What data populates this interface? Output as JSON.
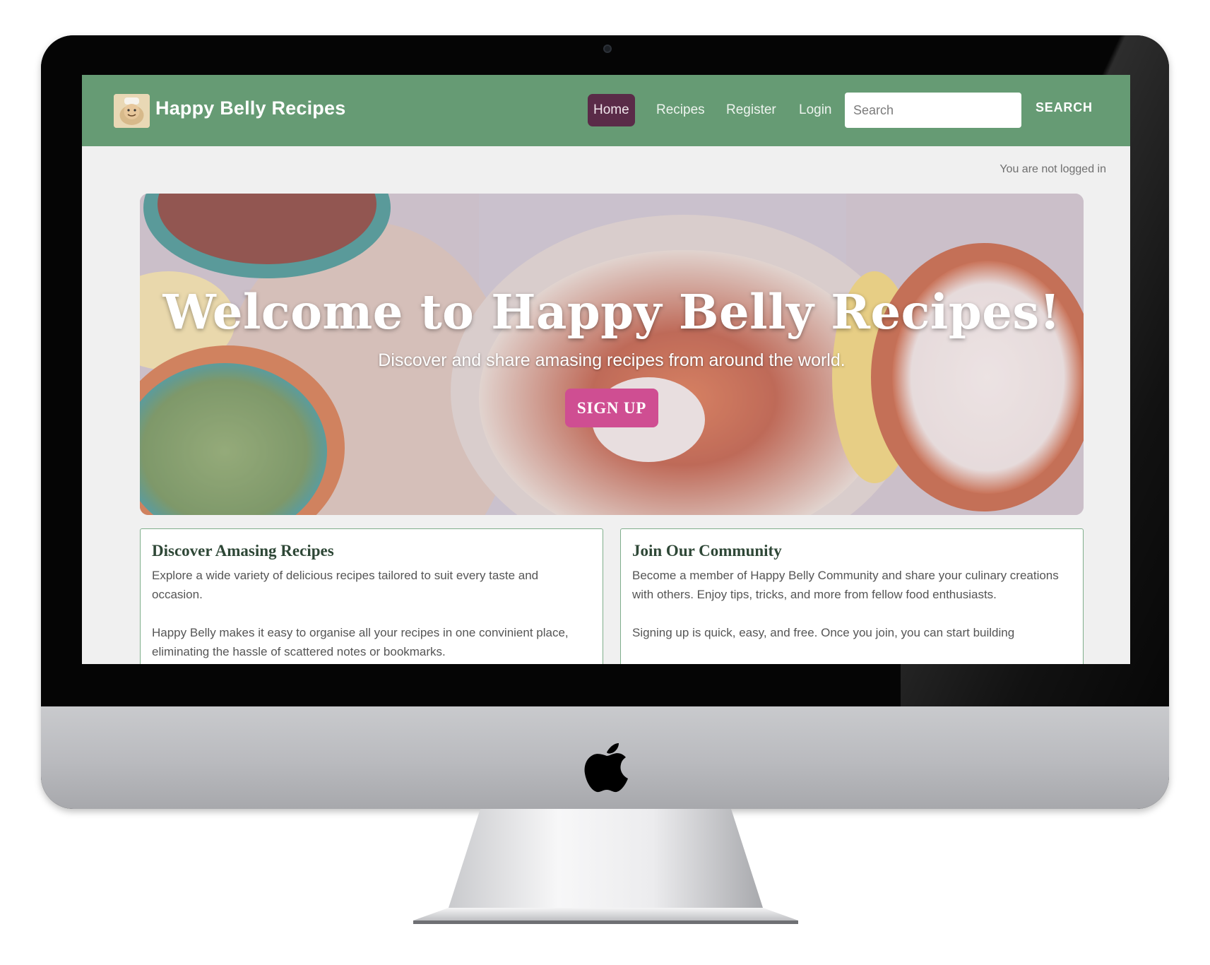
{
  "navbar": {
    "brand": "Happy Belly Recipes",
    "links": [
      "Home",
      "Recipes",
      "Register",
      "Login"
    ],
    "active": "Home",
    "search_placeholder": "Search",
    "search_button": "SEARCH"
  },
  "status": {
    "login_text": "You are not logged in"
  },
  "hero": {
    "title": "Welcome to Happy Belly Recipes!",
    "subtitle": "Discover and share amasing recipes from around the world.",
    "cta": "SIGN UP"
  },
  "cards": [
    {
      "title": "Discover Amasing Recipes",
      "paragraphs": [
        "Explore a wide variety of delicious recipes tailored to suit every taste and occasion.",
        "Happy Belly makes it easy to organise all your recipes in one convinient place, eliminating the hassle of scattered notes or bookmarks."
      ]
    },
    {
      "title": "Join Our Community",
      "paragraphs": [
        "Become a member of Happy Belly Community and share your culinary creations with others. Enjoy tips, tricks, and more from fellow food enthusiasts.",
        "Signing up is quick, easy, and free. Once you join, you can start building"
      ]
    }
  ],
  "colors": {
    "navbar": "#669b74",
    "active_link": "#5a2b48",
    "cta": "#cf4e92",
    "card_border": "#7fae8b"
  },
  "icons": [
    "brand-logo-icon",
    "apple-logo-icon",
    "camera-icon"
  ]
}
